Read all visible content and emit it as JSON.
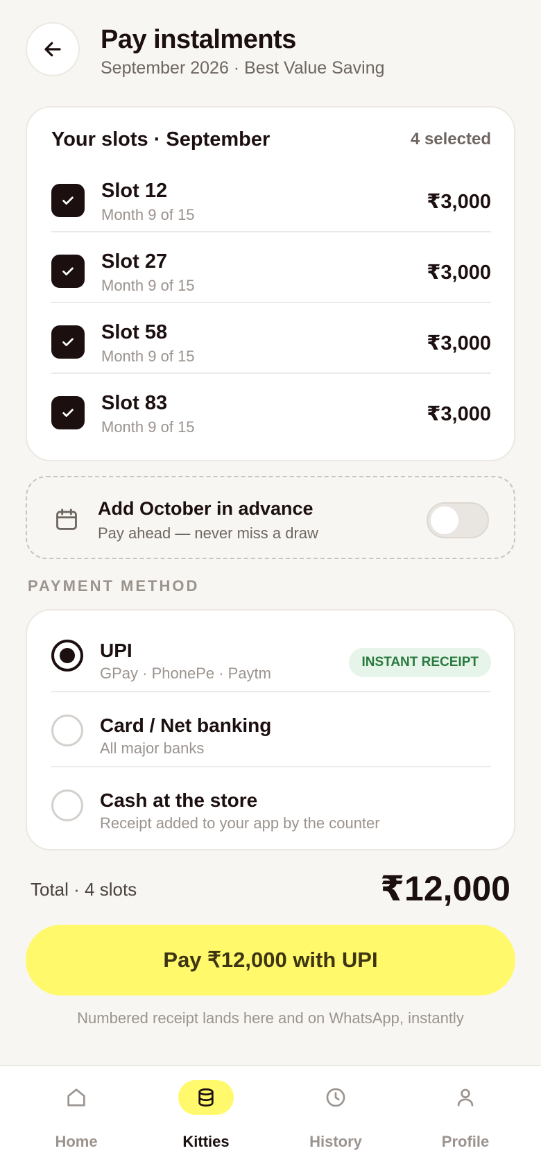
{
  "header": {
    "title": "Pay instalments",
    "subtitle": "September 2026 · Best Value Saving",
    "back_icon": "arrow-left-icon"
  },
  "slots": {
    "title": "Your slots · September",
    "count": "4 selected",
    "items": [
      {
        "name": "Slot 12",
        "meta": "Month 9 of 15",
        "amount": "₹3,000",
        "checked": true
      },
      {
        "name": "Slot 27",
        "meta": "Month 9 of 15",
        "amount": "₹3,000",
        "checked": true
      },
      {
        "name": "Slot 58",
        "meta": "Month 9 of 15",
        "amount": "₹3,000",
        "checked": true
      },
      {
        "name": "Slot 83",
        "meta": "Month 9 of 15",
        "amount": "₹3,000",
        "checked": true
      }
    ]
  },
  "advance": {
    "title": "Add October in advance",
    "subtitle": "Pay ahead — never miss a draw",
    "icon": "calendar-icon",
    "enabled": false
  },
  "payment": {
    "section_label": "PAYMENT METHOD",
    "methods": [
      {
        "name": "UPI",
        "sub": "GPay · PhonePe · Paytm",
        "badge": "INSTANT RECEIPT",
        "selected": true
      },
      {
        "name": "Card / Net banking",
        "sub": "All major banks",
        "selected": false
      },
      {
        "name": "Cash at the store",
        "sub": "Receipt added to your app by the counter",
        "selected": false
      }
    ]
  },
  "total": {
    "label": "Total · 4 slots",
    "amount": "₹12,000"
  },
  "pay_button": "Pay ₹12,000 with UPI",
  "note": "Numbered receipt lands here and on WhatsApp, instantly",
  "tabs": [
    {
      "label": "Home",
      "icon": "home-icon",
      "active": false
    },
    {
      "label": "Kitties",
      "icon": "coins-stack-icon",
      "active": true
    },
    {
      "label": "History",
      "icon": "clock-icon",
      "active": false
    },
    {
      "label": "Profile",
      "icon": "user-icon",
      "active": false
    }
  ],
  "colors": {
    "background": "#f8f6f2",
    "primary_dark": "#1c0f0f",
    "accent_yellow": "#fff96b",
    "badge_green": "#2a7a3e"
  }
}
